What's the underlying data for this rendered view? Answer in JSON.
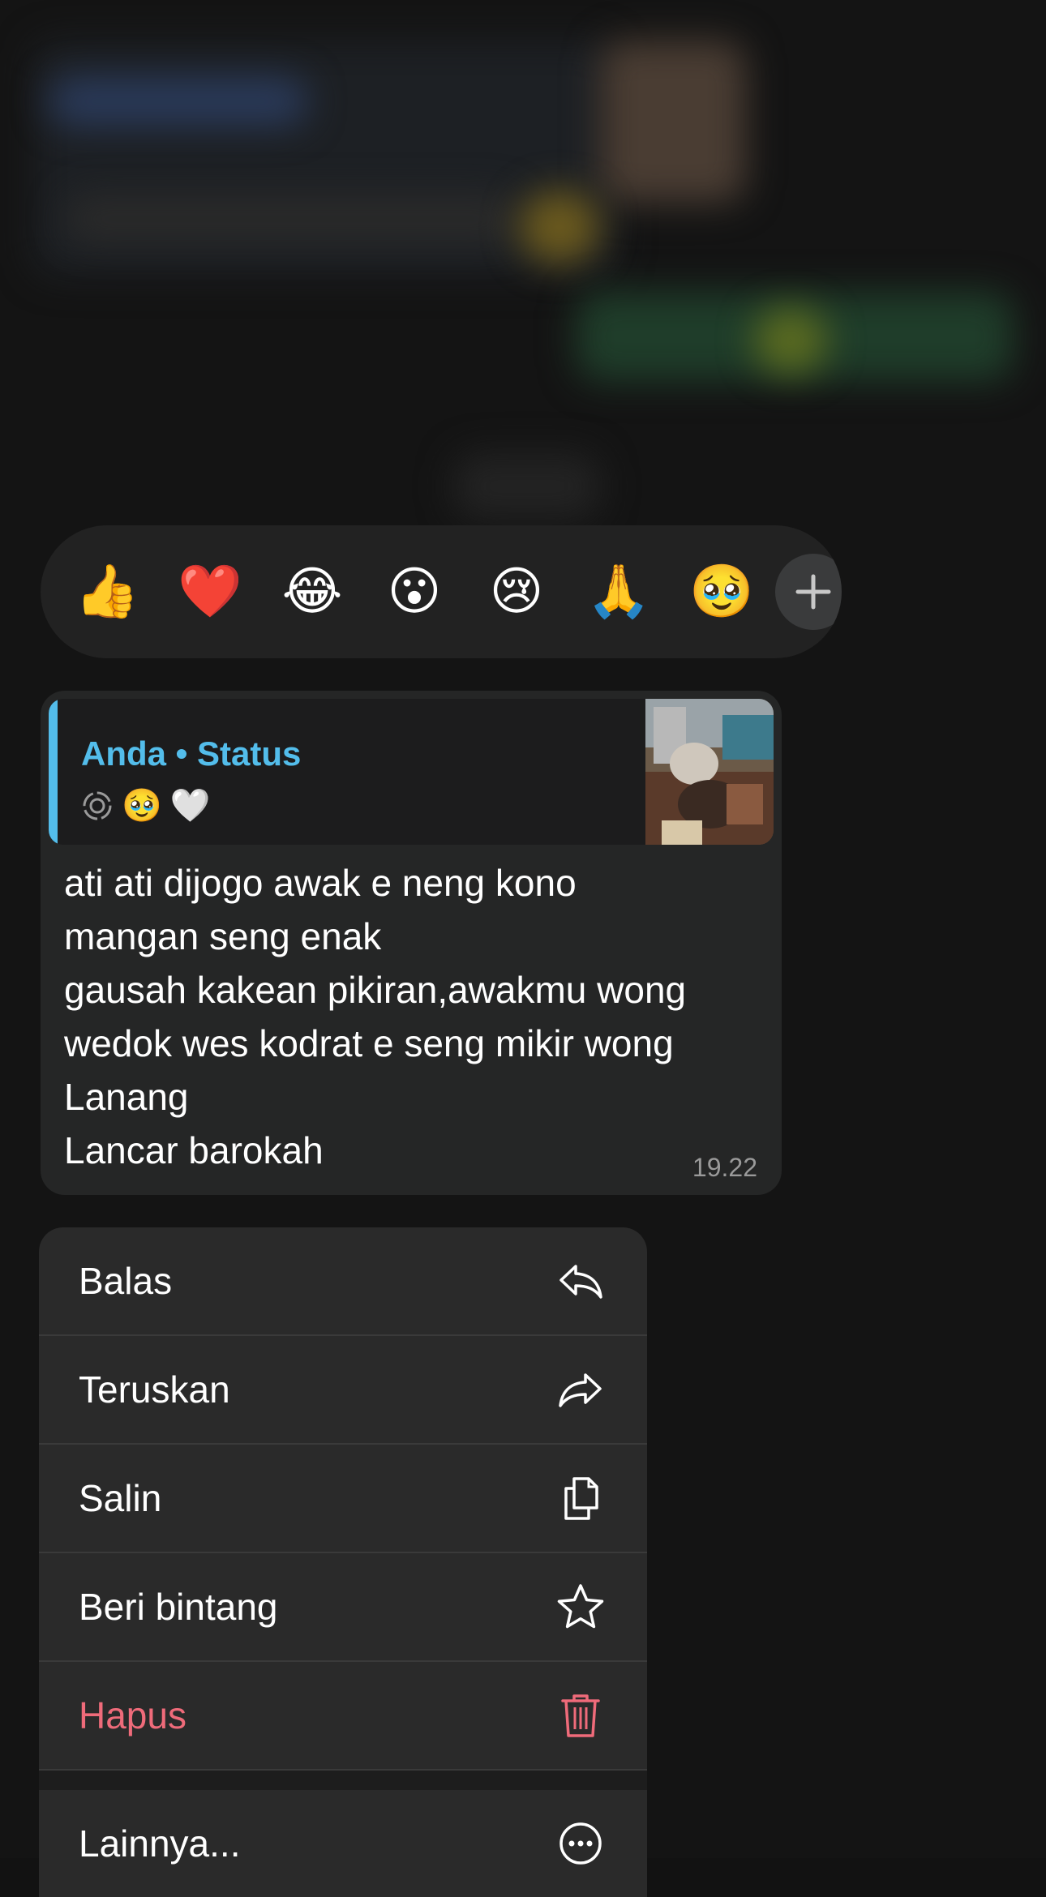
{
  "reactions": [
    "👍",
    "❤️",
    "😂",
    "😮",
    "😢",
    "🙏",
    "🥹"
  ],
  "quote": {
    "author": "Anda • Status",
    "preview_emojis": [
      "🥹",
      "🤍"
    ]
  },
  "message": {
    "lines": [
      "ati ati dijogo awak e neng kono",
      "mangan seng enak",
      "gausah kakean pikiran,awakmu wong",
      "wedok wes kodrat e seng mikir wong",
      "Lanang",
      "Lancar barokah"
    ],
    "time": "19.22"
  },
  "menu": {
    "items": [
      {
        "label": "Balas",
        "icon": "reply-icon"
      },
      {
        "label": "Teruskan",
        "icon": "forward-icon"
      },
      {
        "label": "Salin",
        "icon": "copy-icon"
      },
      {
        "label": "Beri bintang",
        "icon": "star-icon"
      },
      {
        "label": "Hapus",
        "icon": "trash-icon"
      }
    ],
    "more_label": "Lainnya..."
  },
  "colors": {
    "accent_blue": "#53bdeb",
    "delete_red": "#ef6b7a",
    "menu_bg": "#2a2a2a",
    "bubble_bg": "#252626"
  }
}
